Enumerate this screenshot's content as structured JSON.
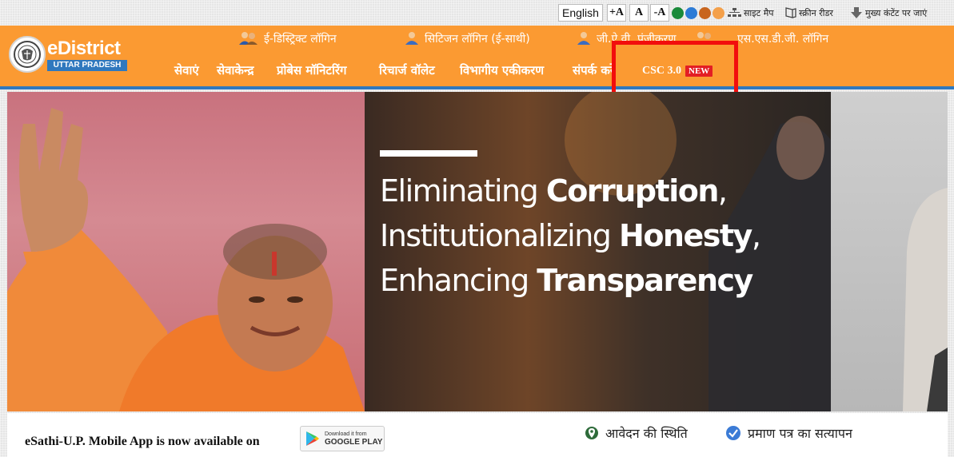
{
  "topbar": {
    "language": "English",
    "font_increase": "+A",
    "font_normal": "A",
    "font_decrease": "-A",
    "theme_colors": [
      "#1a8a3a",
      "#2c7bd6",
      "#c8651e",
      "#f4a04a"
    ],
    "sitemap": "साइट मैप",
    "screen_reader": "स्क्रीन रीडर",
    "skip_to_content": "मुख्य कंटेंट पर जाएं"
  },
  "logo": {
    "title": "eDistrict",
    "subtitle": "UTTAR PRADESH"
  },
  "logins": [
    {
      "label": "ई-डिस्ट्रिक्ट लॉगिन",
      "icon": "users-icon"
    },
    {
      "label": "सिटिजन लॉगिन (ई-साथी)",
      "icon": "citizen-icon"
    },
    {
      "label": "जी.ऐ.वी. पंजीकरण",
      "icon": "user-icon"
    },
    {
      "label": "एस.एस.डी.जी. लॉगिन",
      "icon": "users-icon"
    }
  ],
  "nav": [
    {
      "label": "सेवाएं"
    },
    {
      "label": "सेवाकेन्द्र"
    },
    {
      "label": "प्रोबेस मॉनिटरिंग"
    },
    {
      "label": "रिचार्ज वॉलेट"
    },
    {
      "label": "विभागीय एकीकरण"
    },
    {
      "label": "संपर्क करें"
    }
  ],
  "csc": {
    "label": "CSC 3.0",
    "badge": "NEW"
  },
  "banner": {
    "line1_light": "Eliminating ",
    "line1_bold": "Corruption",
    "line1_end": ",",
    "line2_light": "Institutionalizing ",
    "line2_bold": "Honesty",
    "line2_end": ",",
    "line3_light": "Enhancing ",
    "line3_bold": "Transparency"
  },
  "footer": {
    "app_text": "eSathi-U.P. Mobile App is now available on",
    "play_small": "Download it from",
    "play_big": "GOOGLE PLAY",
    "status": "आवेदन की स्थिति",
    "verify": "प्रमाण पत्र का सत्यापन"
  },
  "colors": {
    "header": "#fb9a32",
    "accent_blue": "#2f78be",
    "highlight": "#f20d0d",
    "new_badge": "#e31e24"
  }
}
